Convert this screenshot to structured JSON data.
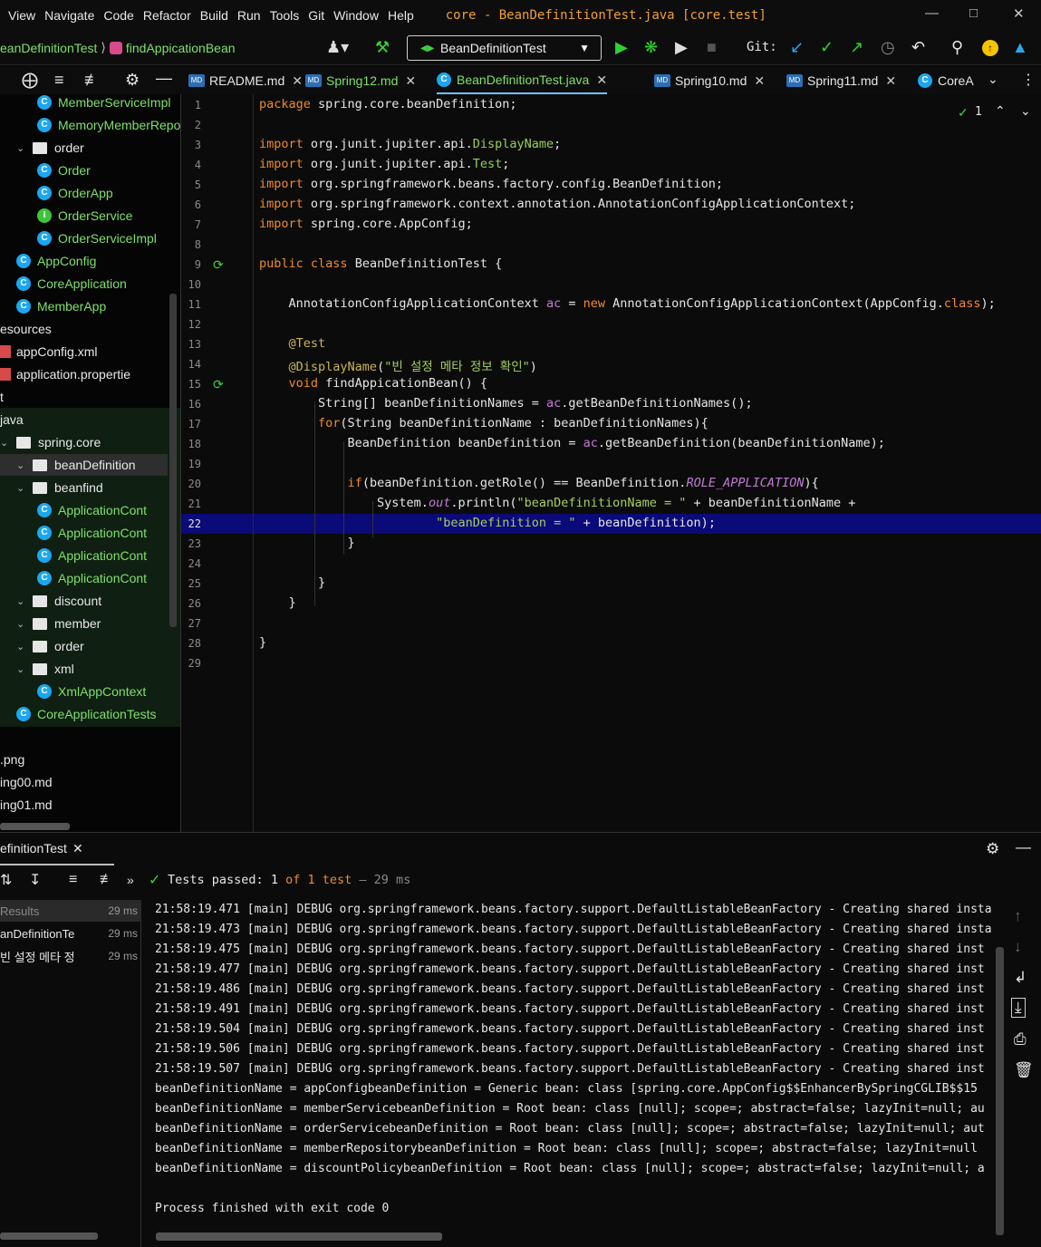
{
  "menu": [
    "View",
    "Navigate",
    "Code",
    "Refactor",
    "Build",
    "Run",
    "Tools",
    "Git",
    "Window",
    "Help"
  ],
  "window_title": "core - BeanDefinitionTest.java [core.test]",
  "breadcrumb": {
    "class": "eanDefinitionTest",
    "method": "findAppicationBean"
  },
  "run_config": "BeanDefinitionTest",
  "git_label": "Git:",
  "tabs": [
    {
      "label": "README.md",
      "icon": "md-icon"
    },
    {
      "label": "Spring12.md",
      "icon": "md-icon"
    },
    {
      "label": "BeanDefinitionTest.java",
      "icon": "class-icon",
      "active": true
    },
    {
      "label": "Spring10.md",
      "icon": "md-icon"
    },
    {
      "label": "Spring11.md",
      "icon": "md-icon"
    },
    {
      "label": "CoreA",
      "icon": "class-icon"
    }
  ],
  "project_tree": [
    {
      "label": "MemberServiceImpl",
      "type": "class",
      "indent": 2
    },
    {
      "label": "MemoryMemberRepos",
      "type": "class",
      "indent": 2
    },
    {
      "label": "order",
      "type": "folder",
      "indent": 1
    },
    {
      "label": "Order",
      "type": "class",
      "indent": 2
    },
    {
      "label": "OrderApp",
      "type": "class",
      "indent": 2
    },
    {
      "label": "OrderService",
      "type": "interface",
      "indent": 2
    },
    {
      "label": "OrderServiceImpl",
      "type": "class",
      "indent": 2
    },
    {
      "label": "AppConfig",
      "type": "class",
      "indent": 1
    },
    {
      "label": "CoreApplication",
      "type": "class",
      "indent": 1
    },
    {
      "label": "MemberApp",
      "type": "class",
      "indent": 1
    },
    {
      "label": "esources",
      "type": "text",
      "indent": 0
    },
    {
      "label": "appConfig.xml",
      "type": "file",
      "indent": 0
    },
    {
      "label": "application.propertie",
      "type": "file",
      "indent": 0
    },
    {
      "label": "t",
      "type": "text",
      "indent": 0
    },
    {
      "label": "java",
      "type": "text",
      "indent": 0
    },
    {
      "label": "spring.core",
      "type": "folder",
      "indent": 0
    },
    {
      "label": "beanDefinition",
      "type": "folder",
      "indent": 1
    },
    {
      "label": "beanfind",
      "type": "folder",
      "indent": 1
    },
    {
      "label": "ApplicationCont",
      "type": "class",
      "indent": 2
    },
    {
      "label": "ApplicationCont",
      "type": "class",
      "indent": 2
    },
    {
      "label": "ApplicationCont",
      "type": "class",
      "indent": 2
    },
    {
      "label": "ApplicationCont",
      "type": "class",
      "indent": 2
    },
    {
      "label": "discount",
      "type": "folder",
      "indent": 1
    },
    {
      "label": "member",
      "type": "folder",
      "indent": 1
    },
    {
      "label": "order",
      "type": "folder",
      "indent": 1
    },
    {
      "label": "xml",
      "type": "folder",
      "indent": 1
    },
    {
      "label": "XmlAppContext",
      "type": "class",
      "indent": 2
    },
    {
      "label": "CoreApplicationTests",
      "type": "class",
      "indent": 1
    },
    {
      "label": "",
      "type": "text",
      "indent": 0
    },
    {
      "label": ".png",
      "type": "text",
      "indent": 0
    },
    {
      "label": "ing00.md",
      "type": "text",
      "indent": 0
    },
    {
      "label": "ing01.md",
      "type": "text",
      "indent": 0
    }
  ],
  "inspection_count": "1",
  "code_lines": [
    "package spring.core.beanDefinition;",
    "",
    "import org.junit.jupiter.api.DisplayName;",
    "import org.junit.jupiter.api.Test;",
    "import org.springframework.beans.factory.config.BeanDefinition;",
    "import org.springframework.context.annotation.AnnotationConfigApplicationContext;",
    "import spring.core.AppConfig;",
    "",
    "public class BeanDefinitionTest {",
    "",
    "    AnnotationConfigApplicationContext ac = new AnnotationConfigApplicationContext(AppConfig.class);",
    "",
    "    @Test",
    "    @DisplayName(\"빈 설정 메타 정보 확인\")",
    "    void findAppicationBean() {",
    "        String[] beanDefinitionNames = ac.getBeanDefinitionNames();",
    "        for(String beanDefinitionName : beanDefinitionNames){",
    "            BeanDefinition beanDefinition = ac.getBeanDefinition(beanDefinitionName);",
    "",
    "            if(beanDefinition.getRole() == BeanDefinition.ROLE_APPLICATION){",
    "                System.out.println(\"beanDefinitionName = \" + beanDefinitionName +",
    "                        \"beanDefinition = \" + beanDefinition);",
    "            }",
    "",
    "        }",
    "    }",
    "",
    "}",
    ""
  ],
  "current_line": 22,
  "run_tab": "efinitionTest",
  "test_status": {
    "prefix": "Tests passed:",
    "passed": "1",
    "of": "of",
    "total": "1 test",
    "time": "– 29 ms"
  },
  "results": [
    {
      "label": "Results",
      "time": "29 ms"
    },
    {
      "label": "anDefinitionTe",
      "time": "29 ms"
    },
    {
      "label": "빈 설정 메타 정",
      "time": "29 ms"
    }
  ],
  "console_lines": [
    "21:58:19.471 [main] DEBUG org.springframework.beans.factory.support.DefaultListableBeanFactory - Creating shared insta",
    "21:58:19.473 [main] DEBUG org.springframework.beans.factory.support.DefaultListableBeanFactory - Creating shared insta",
    "21:58:19.475 [main] DEBUG org.springframework.beans.factory.support.DefaultListableBeanFactory - Creating shared inst",
    "21:58:19.477 [main] DEBUG org.springframework.beans.factory.support.DefaultListableBeanFactory - Creating shared inst",
    "21:58:19.486 [main] DEBUG org.springframework.beans.factory.support.DefaultListableBeanFactory - Creating shared inst",
    "21:58:19.491 [main] DEBUG org.springframework.beans.factory.support.DefaultListableBeanFactory - Creating shared inst",
    "21:58:19.504 [main] DEBUG org.springframework.beans.factory.support.DefaultListableBeanFactory - Creating shared inst",
    "21:58:19.506 [main] DEBUG org.springframework.beans.factory.support.DefaultListableBeanFactory - Creating shared inst",
    "21:58:19.507 [main] DEBUG org.springframework.beans.factory.support.DefaultListableBeanFactory - Creating shared inst",
    "beanDefinitionName = appConfigbeanDefinition = Generic bean: class [spring.core.AppConfig$$EnhancerBySpringCGLIB$$15",
    "beanDefinitionName = memberServicebeanDefinition = Root bean: class [null]; scope=; abstract=false; lazyInit=null; au",
    "beanDefinitionName = orderServicebeanDefinition = Root bean: class [null]; scope=; abstract=false; lazyInit=null; aut",
    "beanDefinitionName = memberRepositorybeanDefinition = Root bean: class [null]; scope=; abstract=false; lazyInit=null",
    "beanDefinitionName = discountPolicybeanDefinition = Root bean: class [null]; scope=; abstract=false; lazyInit=null; a",
    "",
    "Process finished with exit code 0"
  ]
}
